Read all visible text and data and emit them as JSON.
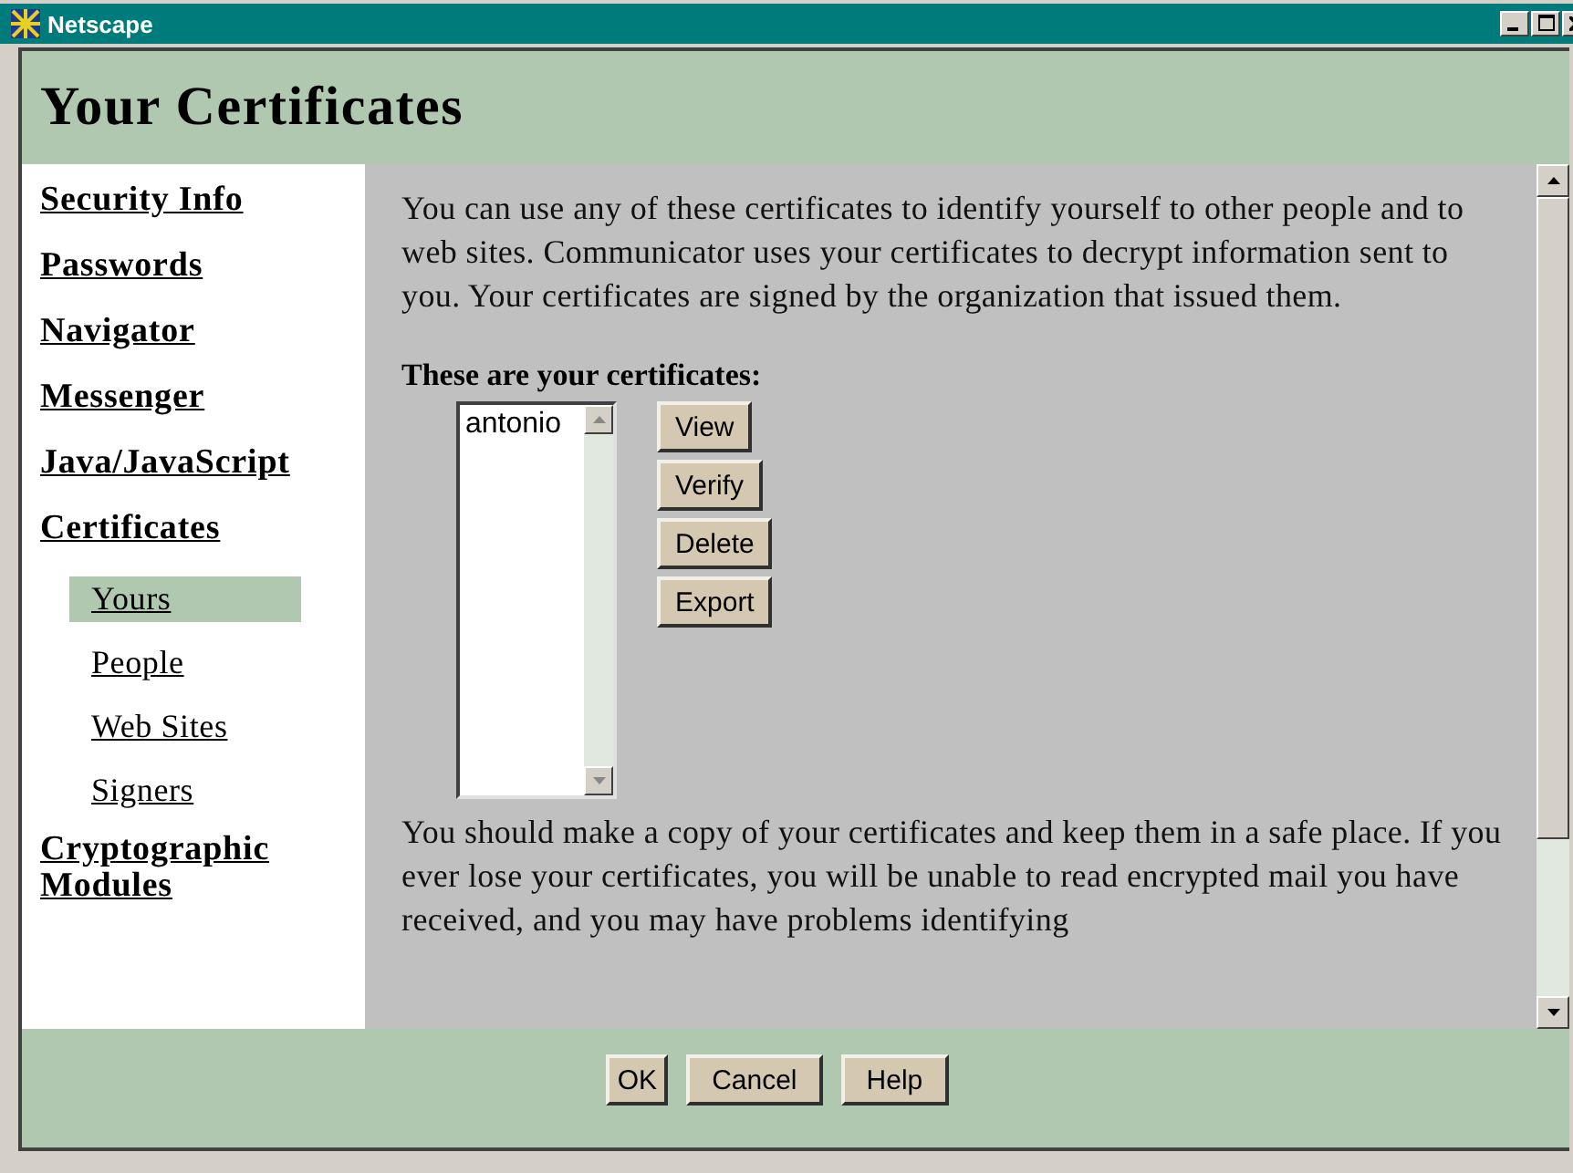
{
  "window": {
    "title": "Netscape"
  },
  "heading": "Your Certificates",
  "sidebar": {
    "items": [
      {
        "label": "Security Info",
        "selected": false
      },
      {
        "label": "Passwords",
        "selected": false
      },
      {
        "label": "Navigator",
        "selected": false
      },
      {
        "label": "Messenger",
        "selected": false
      },
      {
        "label": "Java/JavaScript",
        "selected": false
      },
      {
        "label": "Certificates",
        "selected": false,
        "children": [
          {
            "label": "Yours",
            "selected": true
          },
          {
            "label": "People",
            "selected": false
          },
          {
            "label": "Web Sites",
            "selected": false
          },
          {
            "label": "Signers",
            "selected": false
          }
        ]
      },
      {
        "label": "Cryptographic Modules",
        "selected": false
      }
    ]
  },
  "content": {
    "intro": "You can use any of these certificates to identify yourself to other people and to web sites. Communicator uses your certificates to decrypt information sent to you. Your certificates are signed by the organization that issued them.",
    "list_heading": "These are your certificates:",
    "certificates": [
      "antonio"
    ],
    "actions": [
      "View",
      "Verify",
      "Delete",
      "Export"
    ],
    "note": "You should make a copy of your certificates and keep them in a safe place. If you ever lose your certificates, you will be unable to read encrypted mail you have received, and you may have problems identifying"
  },
  "buttons": [
    "OK",
    "Cancel",
    "Help"
  ]
}
